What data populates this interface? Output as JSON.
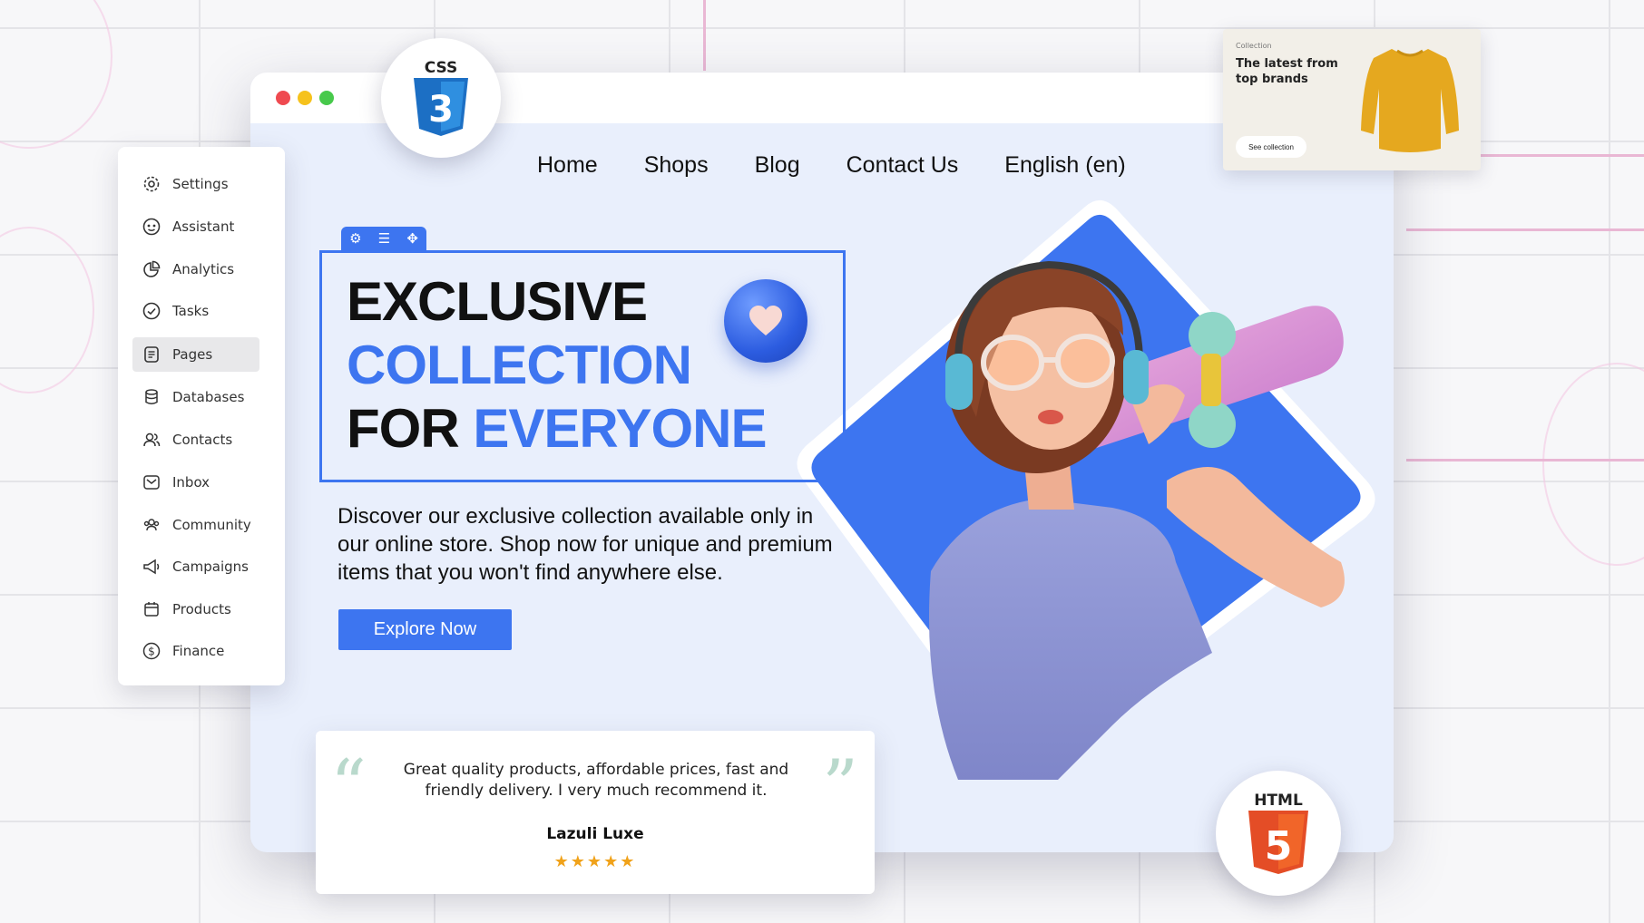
{
  "navigation": {
    "items": [
      "Home",
      "Shops",
      "Blog",
      "Contact Us",
      "English (en)"
    ]
  },
  "hero": {
    "headline_line1": "EXCLUSIVE",
    "headline_line2": "COLLECTION",
    "headline_line3_black": "FOR",
    "headline_line3_blue": "EVERYONE",
    "description": "Discover our exclusive collection available only in our online store. Shop now for unique and premium items that you won't find anywhere else.",
    "cta_label": "Explore Now"
  },
  "sidebar": {
    "items": [
      {
        "label": "Settings",
        "icon": "gear-icon"
      },
      {
        "label": "Assistant",
        "icon": "assistant-icon"
      },
      {
        "label": "Analytics",
        "icon": "pie-chart-icon"
      },
      {
        "label": "Tasks",
        "icon": "check-circle-icon"
      },
      {
        "label": "Pages",
        "icon": "page-icon",
        "active": true
      },
      {
        "label": "Databases",
        "icon": "database-icon"
      },
      {
        "label": "Contacts",
        "icon": "contacts-icon"
      },
      {
        "label": "Inbox",
        "icon": "inbox-icon"
      },
      {
        "label": "Community",
        "icon": "community-icon"
      },
      {
        "label": "Campaigns",
        "icon": "megaphone-icon"
      },
      {
        "label": "Products",
        "icon": "calendar-icon"
      },
      {
        "label": "Finance",
        "icon": "dollar-icon"
      }
    ]
  },
  "badges": {
    "css": "CSS",
    "css_number": "3",
    "html": "HTML",
    "html_number": "5"
  },
  "collection_card": {
    "kicker": "Collection",
    "title": "The latest from top brands",
    "button": "See collection"
  },
  "testimonial": {
    "text": "Great quality products, affordable prices, fast and friendly delivery. I very much recommend it.",
    "author": "Lazuli Luxe",
    "rating": 5,
    "stars": "★★★★★",
    "open_quote": "“",
    "close_quote": "”"
  },
  "colors": {
    "accent": "#3d75f0",
    "page_bg": "#e9effc",
    "star": "#f0a21a",
    "css_shield": "#1c6fc4",
    "html_shield": "#e44d26"
  }
}
